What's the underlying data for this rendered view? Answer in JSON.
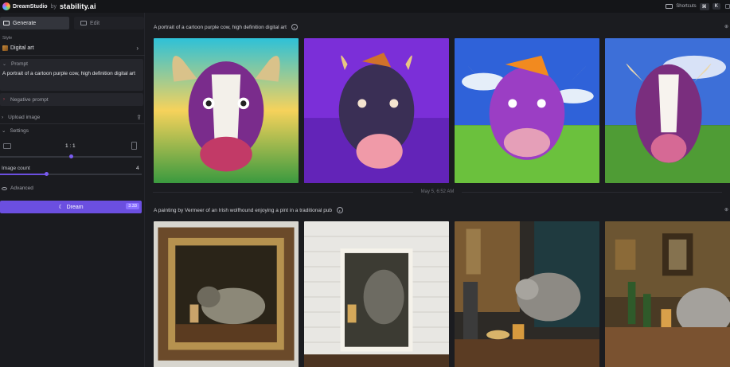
{
  "topbar": {
    "brand": "DreamStudio",
    "by": "by",
    "company": "stability.ai",
    "shortcuts_label": "Shortcuts",
    "kbd1": "⌘",
    "kbd2": "K"
  },
  "sidebar": {
    "tabs": [
      {
        "label": "Generate",
        "icon": "generate-icon",
        "active": true
      },
      {
        "label": "Edit",
        "icon": "edit-icon",
        "active": false
      }
    ],
    "style_label": "Style",
    "style_value": "Digital art",
    "prompt_label": "Prompt",
    "prompt_text": "A portrait of a cartoon purple cow, high definition digital art",
    "negative_prompt_label": "Negative prompt",
    "upload_label": "Upload image",
    "settings_label": "Settings",
    "ratio_value": "1 : 1",
    "ratio_fraction": 0.5,
    "image_count_label": "Image count",
    "image_count_value": "4",
    "image_count_fraction": 0.33,
    "advanced_label": "Advanced",
    "dream_label": "Dream",
    "credits": "3.33"
  },
  "main": {
    "section1_title": "A portrait of a cartoon purple cow, high definition digital art",
    "timestamp": "May 5, 6:52 AM",
    "section2_title": "A painting by Vermeer of an Irish wolfhound enjoying a pint in a traditional pub"
  },
  "colors": {
    "accent": "#6b4fe0",
    "bg": "#17181c",
    "panel": "#25262c"
  }
}
